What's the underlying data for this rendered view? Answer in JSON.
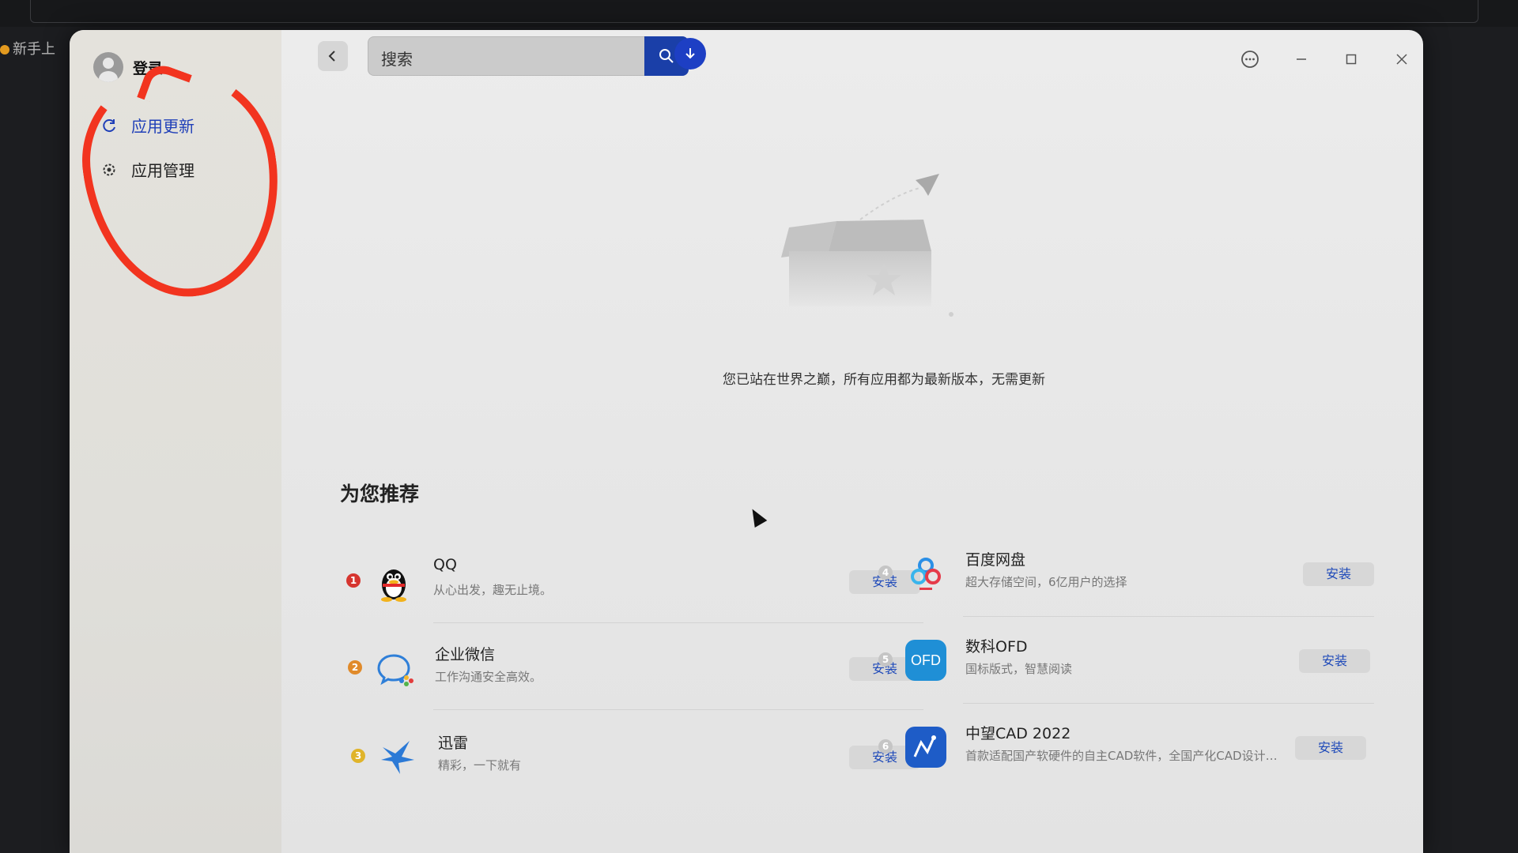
{
  "browser": {
    "tab_fragment": "新手上"
  },
  "sidebar": {
    "login_label": "登录",
    "items": [
      {
        "label": "应用更新",
        "icon": "refresh-icon",
        "active": true
      },
      {
        "label": "应用管理",
        "icon": "gear-icon",
        "active": false
      }
    ]
  },
  "toolbar": {
    "search_placeholder": "搜索",
    "search_icon": "search-icon",
    "download_icon": "download-icon",
    "menu_icon": "more-icon"
  },
  "main": {
    "empty_message": "您已站在世界之巅，所有应用都为最新版本，无需更新",
    "recommend_title": "为您推荐",
    "apps": [
      {
        "rank": "1",
        "name": "QQ",
        "desc": "从心出发，趣无止境。",
        "install": "安装",
        "rank_color": "#d6352f"
      },
      {
        "rank": "2",
        "name": "企业微信",
        "desc": "工作沟通安全高效。",
        "install": "安装",
        "rank_color": "#e08a2a"
      },
      {
        "rank": "3",
        "name": "迅雷",
        "desc": "精彩，一下就有",
        "install": "安装",
        "rank_color": "#e0b42a"
      },
      {
        "rank": "4",
        "name": "百度网盘",
        "desc": "超大存储空间，6亿用户的选择",
        "install": "安装",
        "rank_color": "#bdbdbd"
      },
      {
        "rank": "5",
        "name": "数科OFD",
        "desc": "国标版式，智慧阅读",
        "install": "安装",
        "rank_color": "#bdbdbd",
        "icon_text": "OFD"
      },
      {
        "rank": "6",
        "name": "中望CAD 2022",
        "desc": "首款适配国产软硬件的自主CAD软件，全国产化CAD设计…",
        "install": "安装",
        "rank_color": "#bdbdbd"
      }
    ]
  },
  "colors": {
    "accent": "#1d3fc4",
    "annotation_red": "#f2341f"
  }
}
